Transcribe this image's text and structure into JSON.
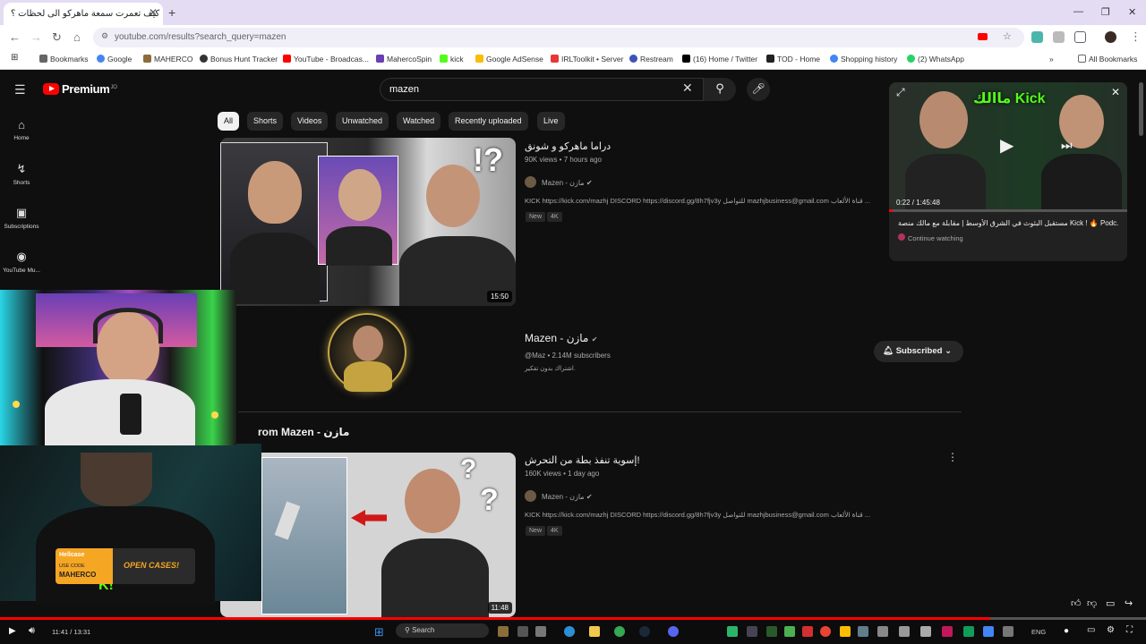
{
  "browser": {
    "tab_title": "كيف تعمرت سمعة ماهركو الى لحظات ؟",
    "tab_suffix": "be",
    "url": "youtube.com/results?search_query=mazen",
    "bookmarks": [
      {
        "label": "Bookmarks",
        "icon": "star-icon",
        "color": "#666666"
      },
      {
        "label": "Google",
        "icon": "google-icon",
        "color": "#4285f4"
      },
      {
        "label": "MAHERCO",
        "icon": "maherco-icon",
        "color": "#8a6d3b"
      },
      {
        "label": "Bonus Hunt Tracker",
        "icon": "bonus-icon",
        "color": "#333333"
      },
      {
        "label": "YouTube - Broadcas...",
        "icon": "youtube-icon",
        "color": "#ff0000"
      },
      {
        "label": "MahercoSpin",
        "icon": "spin-icon",
        "color": "#6a3fb5"
      },
      {
        "label": "kick",
        "icon": "kick-icon",
        "color": "#53fc18"
      },
      {
        "label": "Google AdSense",
        "icon": "adsense-icon",
        "color": "#fbbc04"
      },
      {
        "label": "IRLToolkit • Server",
        "icon": "irl-icon",
        "color": "#e53935"
      },
      {
        "label": "Restream",
        "icon": "restream-icon",
        "color": "#3f51b5"
      },
      {
        "label": "(16) Home / Twitter",
        "icon": "x-icon",
        "color": "#000000"
      },
      {
        "label": "TOD - Home",
        "icon": "tod-icon",
        "color": "#222222"
      },
      {
        "label": "Shopping history",
        "icon": "google-icon",
        "color": "#4285f4"
      },
      {
        "label": "(2) WhatsApp",
        "icon": "whatsapp-icon",
        "color": "#25d366"
      }
    ],
    "all_bookmarks": "All Bookmarks"
  },
  "youtube": {
    "logo": "Premium",
    "logo_sup": "JO",
    "search_value": "mazen",
    "sidebar": [
      {
        "label": "Home",
        "icon": "home-icon",
        "glyph": "⌂"
      },
      {
        "label": "Shorts",
        "icon": "shorts-icon",
        "glyph": "↯"
      },
      {
        "label": "Subscriptions",
        "icon": "subscriptions-icon",
        "glyph": "▣"
      },
      {
        "label": "YouTube Mu...",
        "icon": "music-icon",
        "glyph": "◉"
      }
    ],
    "chips": [
      "All",
      "Shorts",
      "Videos",
      "Unwatched",
      "Watched",
      "Recently uploaded",
      "Live"
    ],
    "video1": {
      "title": "دراما ماهركو و شونق",
      "meta": "90K views • 7 hours ago",
      "channel": "Mazen - مازن",
      "desc": "KICK https://kick.com/mazhj DISCORD https://discord.gg/8h7fjv3y للتواصل mazhjbusiness@gmail.com قناة الألعاب ...",
      "badges": [
        "New",
        "4K"
      ],
      "duration": "15:50"
    },
    "channel": {
      "name": "Mazen - مازن",
      "handle": "@Maz • 2.14M subscribers",
      "desc": "اشتراك بدون تفكير.",
      "subscribed": "Subscribed"
    },
    "section_title": "rom Mazen - مازن",
    "video2": {
      "title": "إسوية تنفذ بطة من التحرش!",
      "meta": "160K views • 1 day ago",
      "channel": "Mazen - مازن",
      "desc": "KICK https://kick.com/mazhj DISCORD https://discord.gg/8h7fjv3y للتواصل mazhjbusiness@gmail.com قناة الألعاب ...",
      "badges": [
        "New",
        "4K"
      ],
      "duration": "11:48"
    },
    "miniplayer": {
      "time": "0:22 / 1:45:48",
      "title": "مستقبل البثوث في الشرق الأوسط | مقابلة مع مالك منصة Kick ! 🔥 Podc...",
      "status": "Continue watching",
      "overlay_text": "ماالك Kick"
    }
  },
  "overlay": {
    "promo_brand": "Hellcase",
    "promo_code_label": "USE CODE",
    "promo_code": "MAHERCO",
    "promo_cta": "OPEN CASES!"
  },
  "player": {
    "time": "11:41 / 13:31",
    "progress": 0.864,
    "search_label": "Search",
    "lang": "ENG"
  }
}
